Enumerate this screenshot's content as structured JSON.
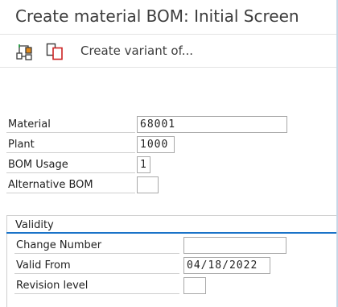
{
  "window": {
    "title": "Create material BOM: Initial Screen"
  },
  "toolbar": {
    "items": [
      {
        "icon": "hierarchy-icon"
      },
      {
        "icon": "copy-icon"
      }
    ],
    "create_variant_label": "Create variant of..."
  },
  "fields": {
    "material": {
      "label": "Material",
      "value": "68001"
    },
    "plant": {
      "label": "Plant",
      "value": "1000"
    },
    "bom_usage": {
      "label": "BOM Usage",
      "value": "1"
    },
    "alternative_bom": {
      "label": "Alternative BOM",
      "value": ""
    }
  },
  "validity": {
    "title": "Validity",
    "change_number": {
      "label": "Change Number",
      "value": ""
    },
    "valid_from": {
      "label": "Valid From",
      "value": "04/18/2022"
    },
    "revision_level": {
      "label": "Revision level",
      "value": ""
    }
  },
  "colors": {
    "accent": "#1a73c8",
    "icon_orange": "#e08a1e",
    "icon_red": "#cc2222"
  }
}
